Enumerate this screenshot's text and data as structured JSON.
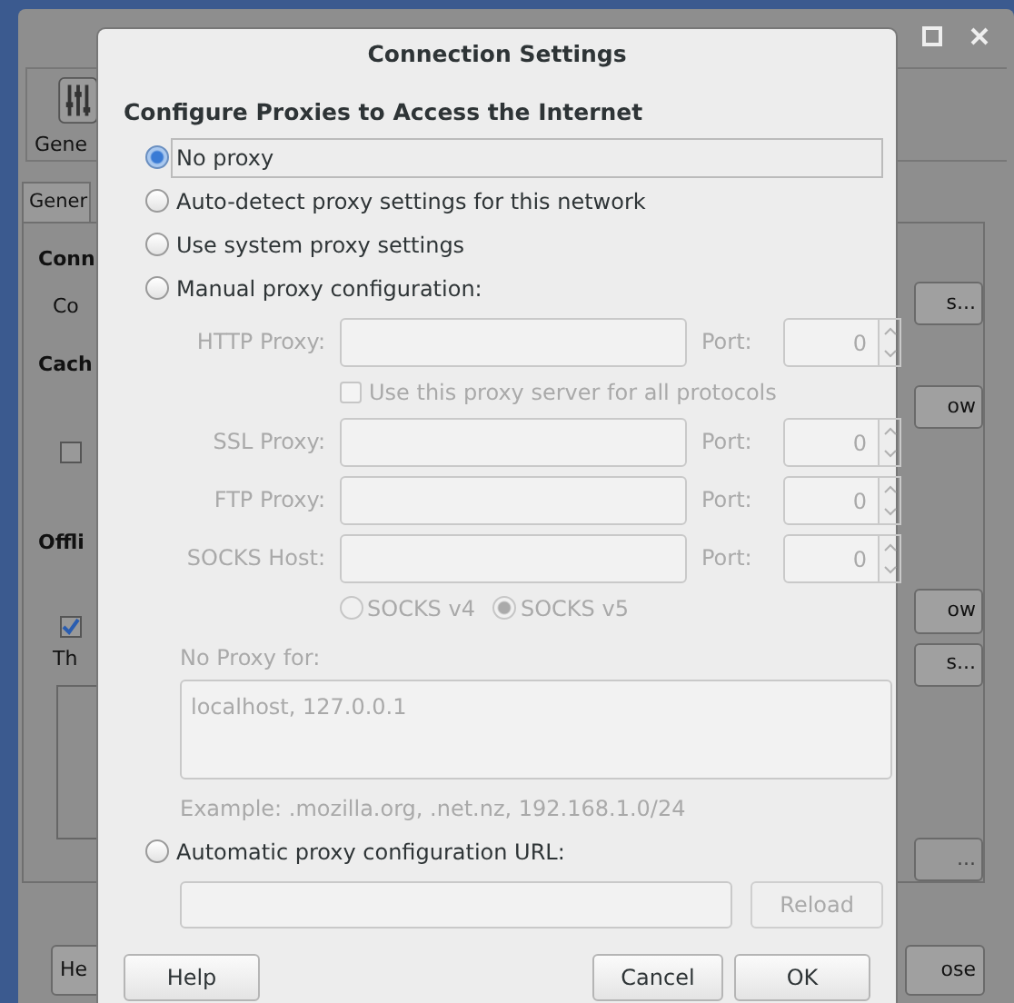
{
  "background_window": {
    "toolbar_label": "Gene",
    "tab_label": "Gener",
    "left_texts": [
      {
        "text": "Conn",
        "kind": "heading"
      },
      {
        "text": "Co",
        "kind": "label"
      },
      {
        "text": "Cach",
        "kind": "heading"
      },
      {
        "kind": "checkbox",
        "checked": false
      },
      {
        "text": "Offli",
        "kind": "heading"
      },
      {
        "kind": "checkbox",
        "checked": true
      },
      {
        "text": "Th",
        "kind": "label"
      },
      {
        "kind": "listbox"
      }
    ],
    "right_buttons": [
      {
        "label": "s...",
        "disabled": false
      },
      {
        "label": "ow",
        "disabled": false
      },
      {
        "label": "ow",
        "disabled": false
      },
      {
        "label": "s...",
        "disabled": false
      },
      {
        "label": "...",
        "disabled": true
      }
    ],
    "bottom_left_button": "He",
    "bottom_right_button": "ose"
  },
  "dialog": {
    "title": "Connection Settings",
    "heading": "Configure Proxies to Access the Internet",
    "options": [
      {
        "label": "No proxy",
        "selected": true
      },
      {
        "label": "Auto-detect proxy settings for this network",
        "selected": false
      },
      {
        "label": "Use system proxy settings",
        "selected": false
      },
      {
        "label": "Manual proxy configuration:",
        "selected": false
      }
    ],
    "manual": {
      "disabled": true,
      "rows": [
        {
          "kind": "proxy",
          "label": "HTTP Proxy:",
          "port_label": "Port:",
          "port": "0"
        },
        {
          "kind": "checkbox",
          "label": "Use this proxy server for all protocols",
          "checked": false
        },
        {
          "kind": "proxy",
          "label": "SSL Proxy:",
          "port_label": "Port:",
          "port": "0"
        },
        {
          "kind": "proxy",
          "label": "FTP Proxy:",
          "port_label": "Port:",
          "port": "0"
        },
        {
          "kind": "proxy",
          "label": "SOCKS Host:",
          "port_label": "Port:",
          "port": "0"
        },
        {
          "kind": "socks",
          "versions": [
            {
              "label": "SOCKS v4",
              "selected": false
            },
            {
              "label": "SOCKS v5",
              "selected": true
            }
          ]
        }
      ],
      "no_proxy_label": "No Proxy for:",
      "no_proxy_value": "localhost, 127.0.0.1",
      "example": "Example: .mozilla.org, .net.nz, 192.168.1.0/24"
    },
    "autoconfig": {
      "label": "Automatic proxy configuration URL:",
      "selected": false,
      "disabled": true,
      "reload": "Reload"
    },
    "buttons": [
      {
        "label": "Help",
        "kind": "help"
      },
      {
        "label": "Cancel",
        "kind": "cancel"
      },
      {
        "label": "OK",
        "kind": "ok"
      }
    ]
  }
}
